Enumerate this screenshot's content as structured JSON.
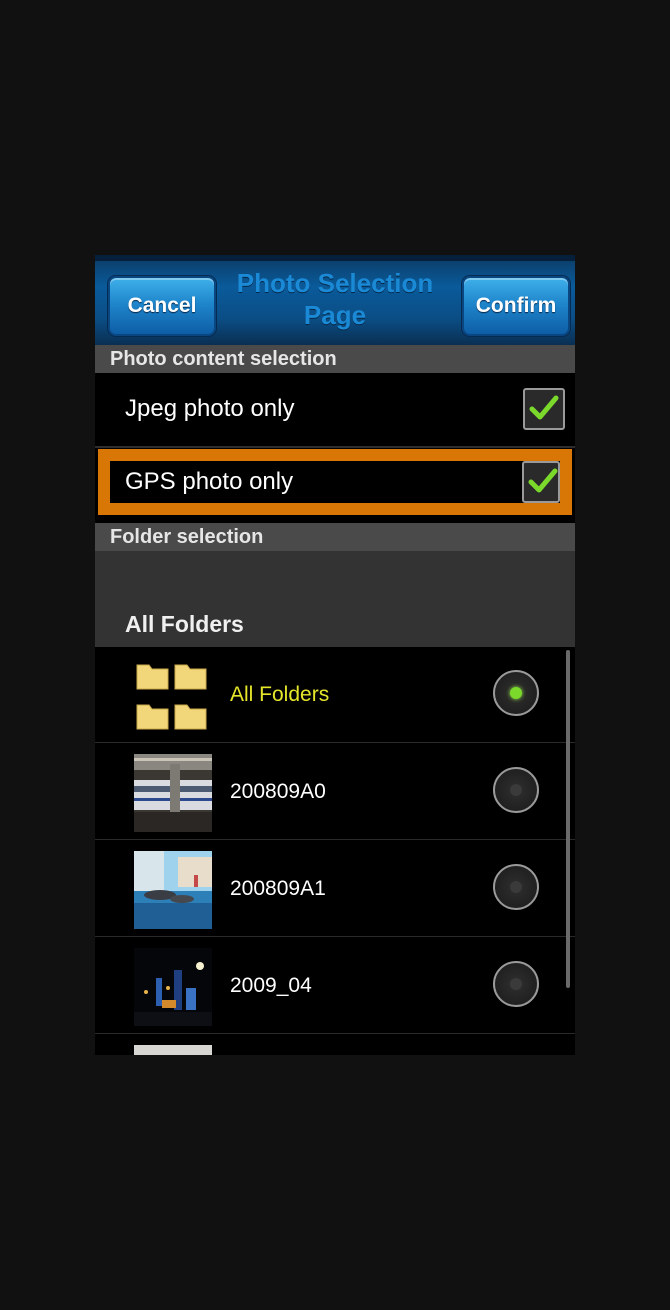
{
  "header": {
    "cancel_label": "Cancel",
    "title": "Photo Selection Page",
    "confirm_label": "Confirm"
  },
  "photo_content": {
    "section_title": "Photo content selection",
    "options": [
      {
        "label": "Jpeg photo only",
        "checked": true
      },
      {
        "label": "GPS photo only",
        "checked": true
      }
    ]
  },
  "folder_selection": {
    "section_title": "Folder selection",
    "subtitle": "All Folders",
    "items": [
      {
        "label": "All Folders",
        "selected": true
      },
      {
        "label": "200809A0",
        "selected": false
      },
      {
        "label": "200809A1",
        "selected": false
      },
      {
        "label": "2009_04",
        "selected": false
      }
    ]
  },
  "colors": {
    "highlight": "#d97706",
    "check": "#7ad92a",
    "active_text": "#e4e62a"
  }
}
